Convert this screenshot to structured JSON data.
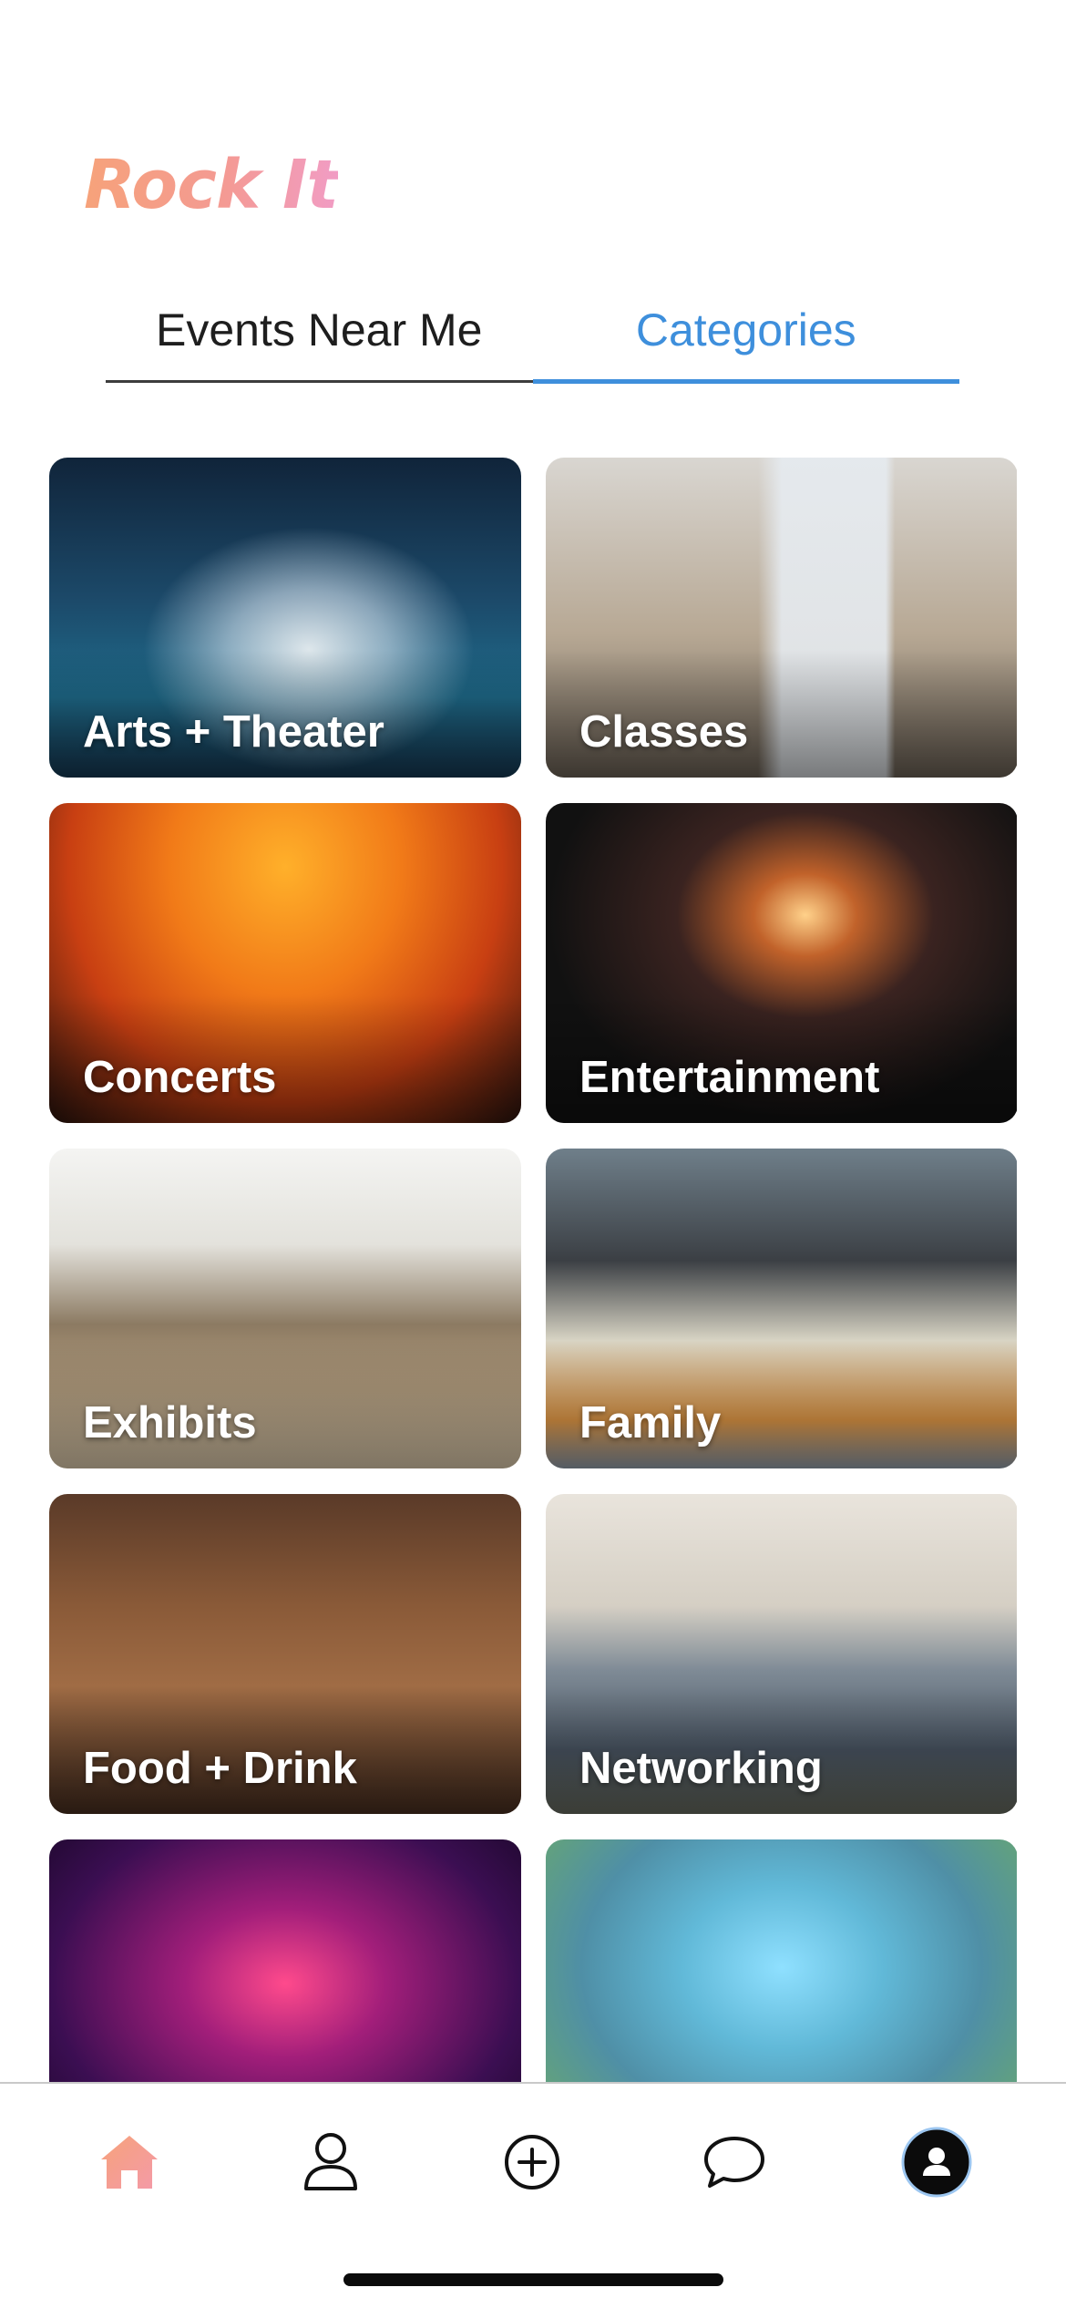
{
  "app": {
    "logo": "Rock It"
  },
  "tabs": [
    {
      "label": "Events Near Me",
      "active": false
    },
    {
      "label": "Categories",
      "active": true
    }
  ],
  "categories": [
    {
      "label": "Arts + Theater"
    },
    {
      "label": "Classes"
    },
    {
      "label": "Concerts"
    },
    {
      "label": "Entertainment"
    },
    {
      "label": "Exhibits"
    },
    {
      "label": "Family"
    },
    {
      "label": "Food + Drink"
    },
    {
      "label": "Networking"
    },
    {
      "label": ""
    },
    {
      "label": ""
    }
  ],
  "bottom_nav": [
    {
      "icon": "home-icon",
      "active": true
    },
    {
      "icon": "user-icon",
      "active": false
    },
    {
      "icon": "plus-circle-icon",
      "active": false
    },
    {
      "icon": "chat-bubble-icon",
      "active": false
    },
    {
      "icon": "account-avatar-icon",
      "active": false
    }
  ],
  "colors": {
    "accent_blue": "#3e8fdc",
    "logo_gradient": [
      "#f6a27a",
      "#f19cc4"
    ],
    "home_active": "#f7a08f"
  }
}
